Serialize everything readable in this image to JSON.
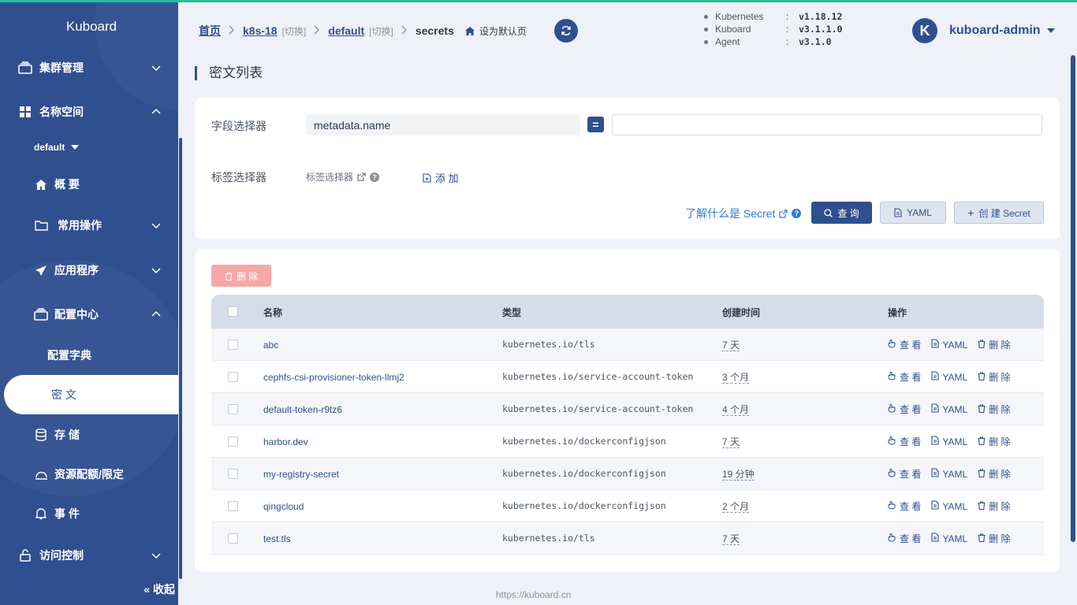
{
  "app": {
    "logo": "Kuboard"
  },
  "sidebar": {
    "cluster": {
      "label": "集群管理"
    },
    "namespace": {
      "label": "名称空间",
      "current": "default"
    },
    "overview": {
      "label": "概 要"
    },
    "ops": {
      "label": "常用操作"
    },
    "apps": {
      "label": "应用程序"
    },
    "config": {
      "label": "配置中心"
    },
    "configmap": {
      "label": "配置字典"
    },
    "secret": {
      "label": "密 文"
    },
    "storage": {
      "label": "存 储"
    },
    "quota": {
      "label": "资源配额/限定"
    },
    "events": {
      "label": "事 件"
    },
    "access": {
      "label": "访问控制"
    },
    "collapse": "收起"
  },
  "breadcrumb": {
    "home": "首页",
    "cluster": "k8s-18",
    "cluster_switch": "[切换]",
    "namespace": "default",
    "namespace_switch": "[切换]",
    "current": "secrets",
    "set_default": "设为默认页"
  },
  "versions": [
    {
      "name": "Kubernetes",
      "value": "v1.18.12"
    },
    {
      "name": "Kuboard",
      "value": "v3.1.1.0"
    },
    {
      "name": "Agent",
      "value": "v3.1.0"
    }
  ],
  "user": {
    "initial": "K",
    "name": "kuboard-admin"
  },
  "page": {
    "title": "密文列表"
  },
  "filter": {
    "field_selector_label": "字段选择器",
    "field_selector_value": "metadata.name",
    "eq": "=",
    "field_input_value": "",
    "label_selector_label": "标签选择器",
    "label_selector_link": "标签选择器",
    "add": "添 加",
    "learn": "了解什么是 Secret",
    "query": "查 询",
    "yaml": "YAML",
    "create": "创 建 Secret"
  },
  "table": {
    "delete_btn": "删 除",
    "headers": {
      "name": "名称",
      "type": "类型",
      "created": "创建时间",
      "ops": "操作"
    },
    "op_labels": {
      "view": "查 看",
      "yaml": "YAML",
      "delete": "删 除"
    },
    "rows": [
      {
        "name": "abc",
        "type": "kubernetes.io/tls",
        "created": "7 天"
      },
      {
        "name": "cephfs-csi-provisioner-token-llmj2",
        "type": "kubernetes.io/service-account-token",
        "created": "3 个月"
      },
      {
        "name": "default-token-r9tz6",
        "type": "kubernetes.io/service-account-token",
        "created": "4 个月"
      },
      {
        "name": "harbor.dev",
        "type": "kubernetes.io/dockerconfigjson",
        "created": "7 天"
      },
      {
        "name": "my-registry-secret",
        "type": "kubernetes.io/dockerconfigjson",
        "created": "19 分钟"
      },
      {
        "name": "qingcloud",
        "type": "kubernetes.io/dockerconfigjson",
        "created": "2 个月"
      },
      {
        "name": "test.tls",
        "type": "kubernetes.io/tls",
        "created": "7 天"
      }
    ]
  },
  "footer": "https://kuboard.cn",
  "colors": {
    "primary": "#2f4f8f",
    "accent": "#1fc29a",
    "danger_light": "#f6a7a8",
    "link": "#2f7ad8"
  }
}
